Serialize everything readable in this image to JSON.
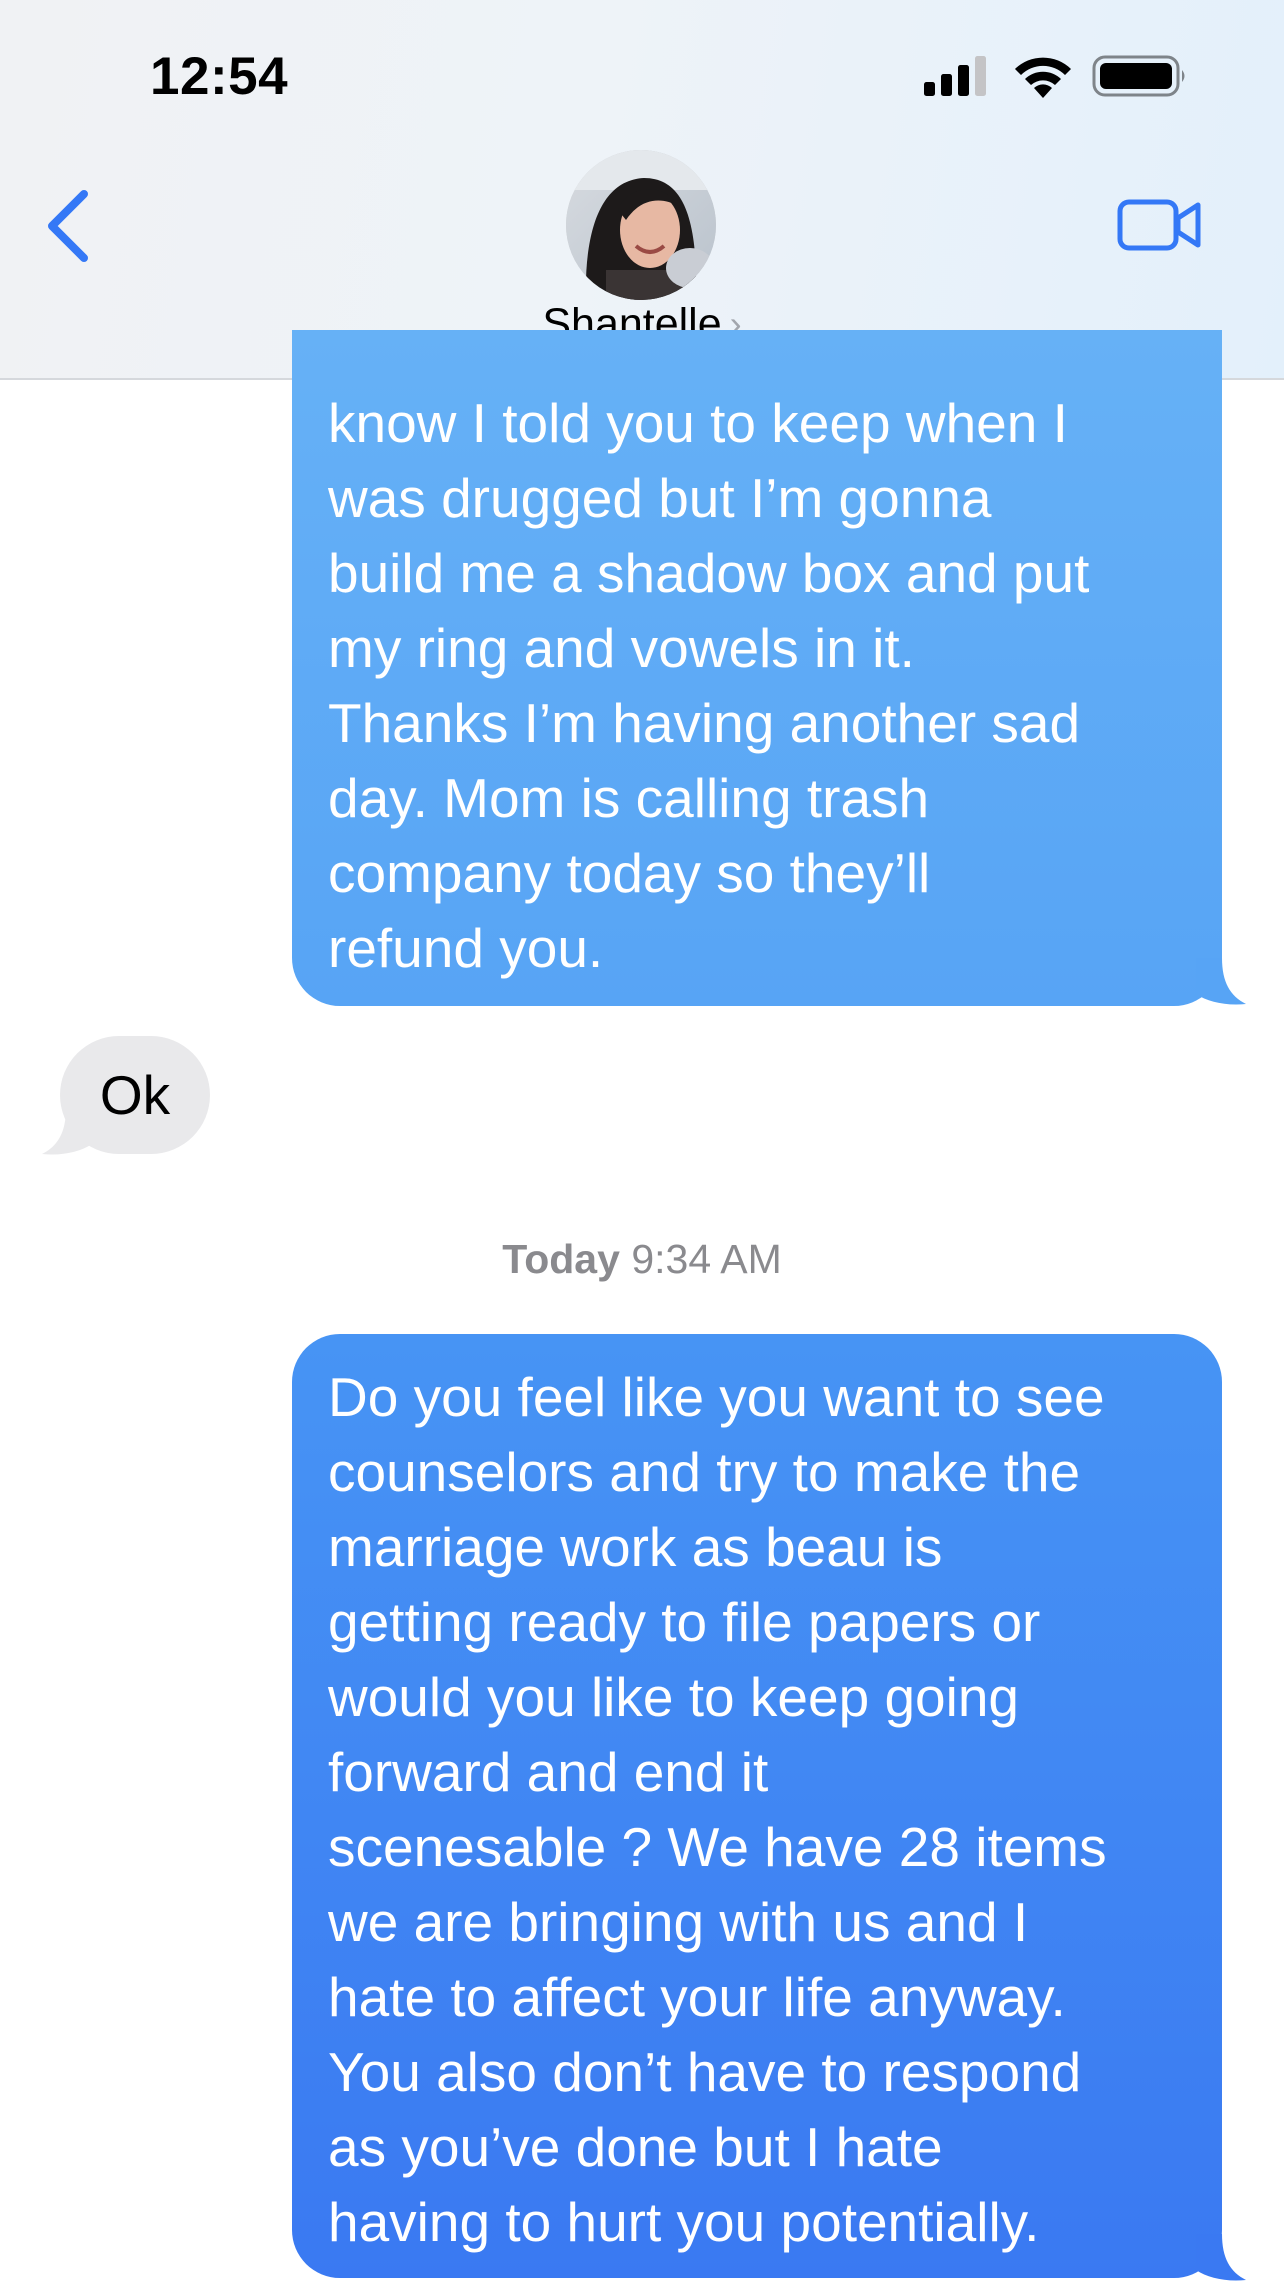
{
  "status_bar": {
    "time": "12:54"
  },
  "header": {
    "contact_name": "Shantelle",
    "chevron": "›",
    "back_icon": "chevron-left-icon",
    "video_icon": "video-camera-icon",
    "accent_color": "#3478f6"
  },
  "messages": [
    {
      "direction": "outgoing",
      "text": "know I told you to keep when I\nwas drugged but I’m gonna\nbuild me a shadow box and put\nmy ring and vowels in it.\nThanks I’m having another sad\nday. Mom is calling trash\ncompany today so they’ll\nrefund you."
    },
    {
      "direction": "incoming",
      "text": "Ok"
    },
    {
      "direction": "outgoing",
      "text": "Do you feel like you want to see\ncounselors and try to make the\nmarriage work as beau is\ngetting ready to file papers or\nwould you like to keep going\nforward and end it\nscenesable ? We have 28 items\nwe are bringing with us and I\nhate to affect your life anyway.\nYou also don’t have to respond\nas you’ve done but I hate\nhaving to hurt you potentially."
    }
  ],
  "timestamp": {
    "day": "Today",
    "time": "9:34 AM"
  },
  "colors": {
    "outgoing_bubble": "#3d80f3",
    "incoming_bubble": "#e9e9eb",
    "timestamp_text": "#8a8a8e"
  }
}
